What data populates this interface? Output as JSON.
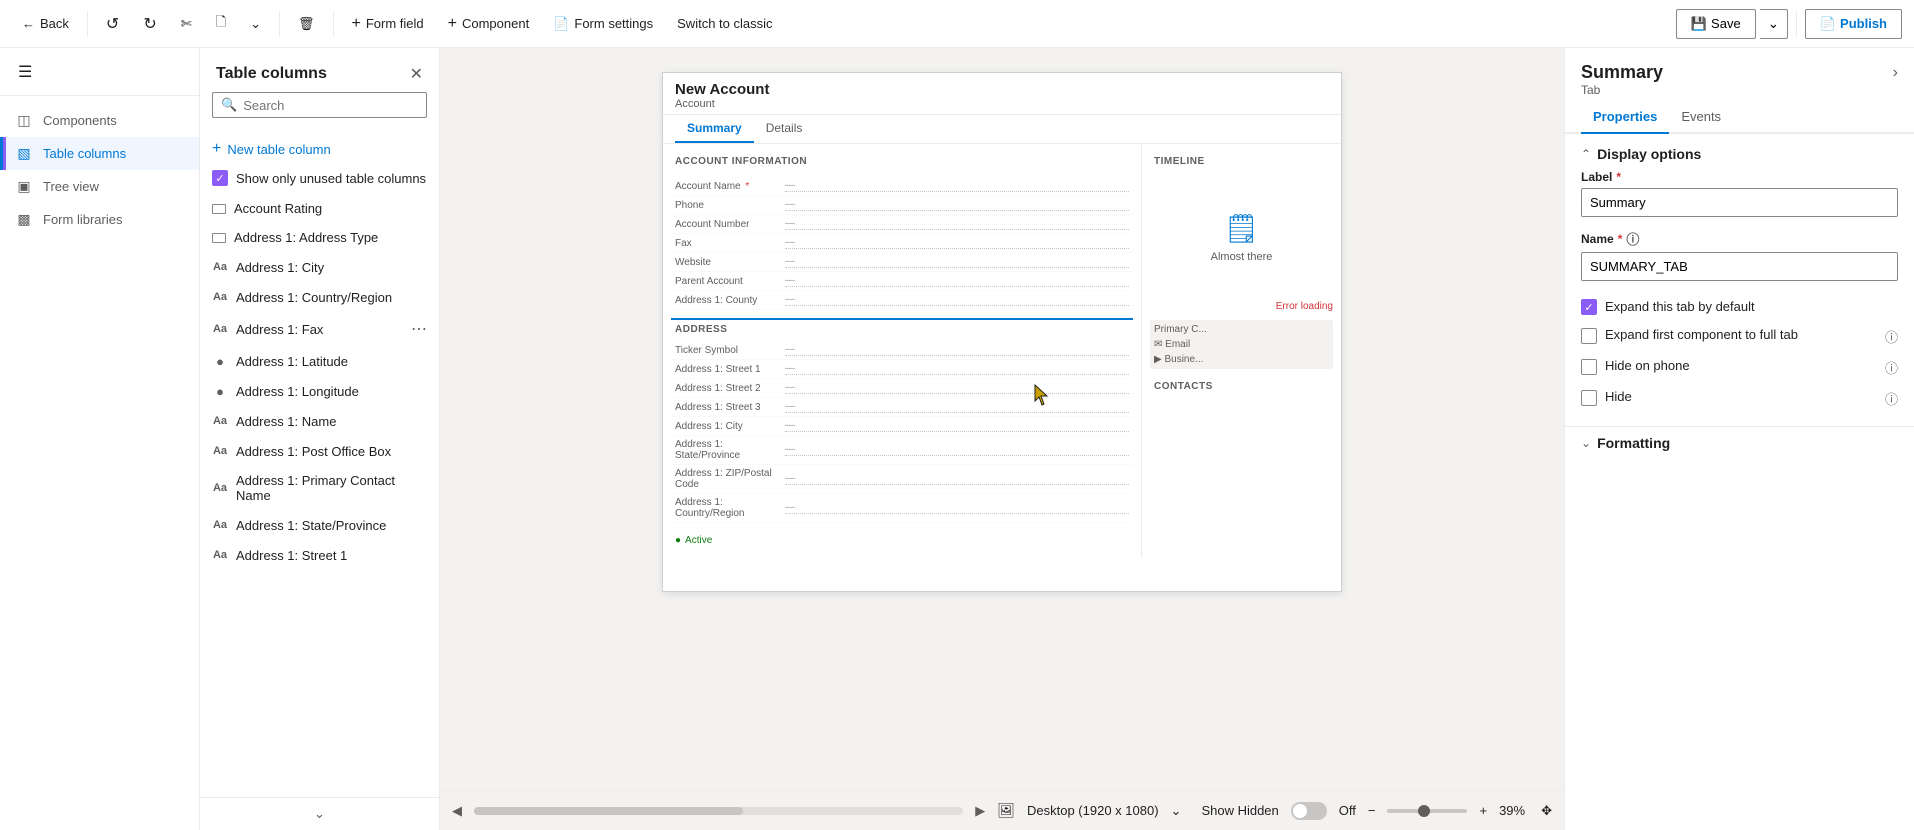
{
  "toolbar": {
    "back_label": "Back",
    "form_field_label": "Form field",
    "component_label": "Component",
    "form_settings_label": "Form settings",
    "switch_classic_label": "Switch to classic",
    "save_label": "Save",
    "publish_label": "Publish"
  },
  "left_sidebar": {
    "hamburger_label": "Menu",
    "nav_items": [
      {
        "id": "components",
        "label": "Components",
        "icon": "grid"
      },
      {
        "id": "table-columns",
        "label": "Table columns",
        "icon": "table",
        "active": true
      },
      {
        "id": "tree-view",
        "label": "Tree view",
        "icon": "tree"
      },
      {
        "id": "form-libraries",
        "label": "Form libraries",
        "icon": "library"
      }
    ]
  },
  "table_columns_panel": {
    "title": "Table columns",
    "search_placeholder": "Search",
    "new_column_label": "New table column",
    "show_unused_label": "Show only unused table columns",
    "columns": [
      {
        "id": "account-rating",
        "label": "Account Rating",
        "icon": "rectangle"
      },
      {
        "id": "address1-address-type",
        "label": "Address 1: Address Type",
        "icon": "rectangle"
      },
      {
        "id": "address1-city",
        "label": "Address 1: City",
        "icon": "text"
      },
      {
        "id": "address1-country",
        "label": "Address 1: Country/Region",
        "icon": "text"
      },
      {
        "id": "address1-fax",
        "label": "Address 1: Fax",
        "icon": "text",
        "show_more": true
      },
      {
        "id": "address1-latitude",
        "label": "Address 1: Latitude",
        "icon": "circle"
      },
      {
        "id": "address1-longitude",
        "label": "Address 1: Longitude",
        "icon": "circle"
      },
      {
        "id": "address1-name",
        "label": "Address 1: Name",
        "icon": "text"
      },
      {
        "id": "address1-post-office-box",
        "label": "Address 1: Post Office Box",
        "icon": "text"
      },
      {
        "id": "address1-primary-contact-name",
        "label": "Address 1: Primary Contact Name",
        "icon": "text"
      },
      {
        "id": "address1-state-province",
        "label": "Address 1: State/Province",
        "icon": "text"
      },
      {
        "id": "address1-street1",
        "label": "Address 1: Street 1",
        "icon": "text"
      }
    ]
  },
  "form_preview": {
    "title": "New Account",
    "subtitle": "Account",
    "tabs": [
      "Summary",
      "Details"
    ],
    "active_tab": "Summary",
    "account_info_section": "ACCOUNT INFORMATION",
    "timeline_section": "Timeline",
    "address_section": "ADDRESS",
    "contacts_section": "CONTACTS",
    "error_text": "Error loading",
    "fields_main": [
      {
        "label": "Account Name",
        "required": true,
        "value": "—"
      },
      {
        "label": "Phone",
        "value": "—"
      },
      {
        "label": "Account Number",
        "value": "—"
      },
      {
        "label": "Fax",
        "value": "—"
      },
      {
        "label": "Website",
        "value": "—"
      },
      {
        "label": "Parent Account",
        "value": "—"
      },
      {
        "label": "Address 1: County",
        "value": "—"
      }
    ],
    "fields_address": [
      {
        "label": "Ticker Symbol",
        "value": "—"
      },
      {
        "label": "Address 1: Street 1",
        "value": "—"
      },
      {
        "label": "Address 1: Street 2",
        "value": "—"
      },
      {
        "label": "Address 1: Street 3",
        "value": "—"
      },
      {
        "label": "Address 1: City",
        "value": "—"
      },
      {
        "label": "Address 1: State/Province",
        "value": "—"
      },
      {
        "label": "Address 1: ZIP/Postal Code",
        "value": "—"
      },
      {
        "label": "Address 1: Country/Region",
        "value": "—"
      }
    ],
    "timeline_almost_text": "Almost there",
    "status_label": "Active"
  },
  "canvas_bottom": {
    "status_icon": "desktop",
    "device_label": "Desktop (1920 x 1080)",
    "show_hidden_label": "Show Hidden",
    "toggle_state": "Off",
    "zoom_level": "39%"
  },
  "right_panel": {
    "title": "Summary",
    "subtitle": "Tab",
    "close_label": ">",
    "tabs": [
      "Properties",
      "Events"
    ],
    "active_tab": "Properties",
    "display_options": {
      "section_title": "Display options",
      "label_field": {
        "label": "Label",
        "required": true,
        "value": "Summary"
      },
      "name_field": {
        "label": "Name",
        "required": true,
        "value": "SUMMARY_TAB"
      },
      "options": [
        {
          "id": "expand-default",
          "label": "Expand this tab by default",
          "checked": true,
          "info": false
        },
        {
          "id": "expand-full",
          "label": "Expand first component to full tab",
          "checked": false,
          "info": true
        },
        {
          "id": "hide-phone",
          "label": "Hide on phone",
          "checked": false,
          "info": true
        },
        {
          "id": "hide",
          "label": "Hide",
          "checked": false,
          "info": true
        }
      ]
    },
    "formatting": {
      "section_title": "Formatting"
    }
  }
}
